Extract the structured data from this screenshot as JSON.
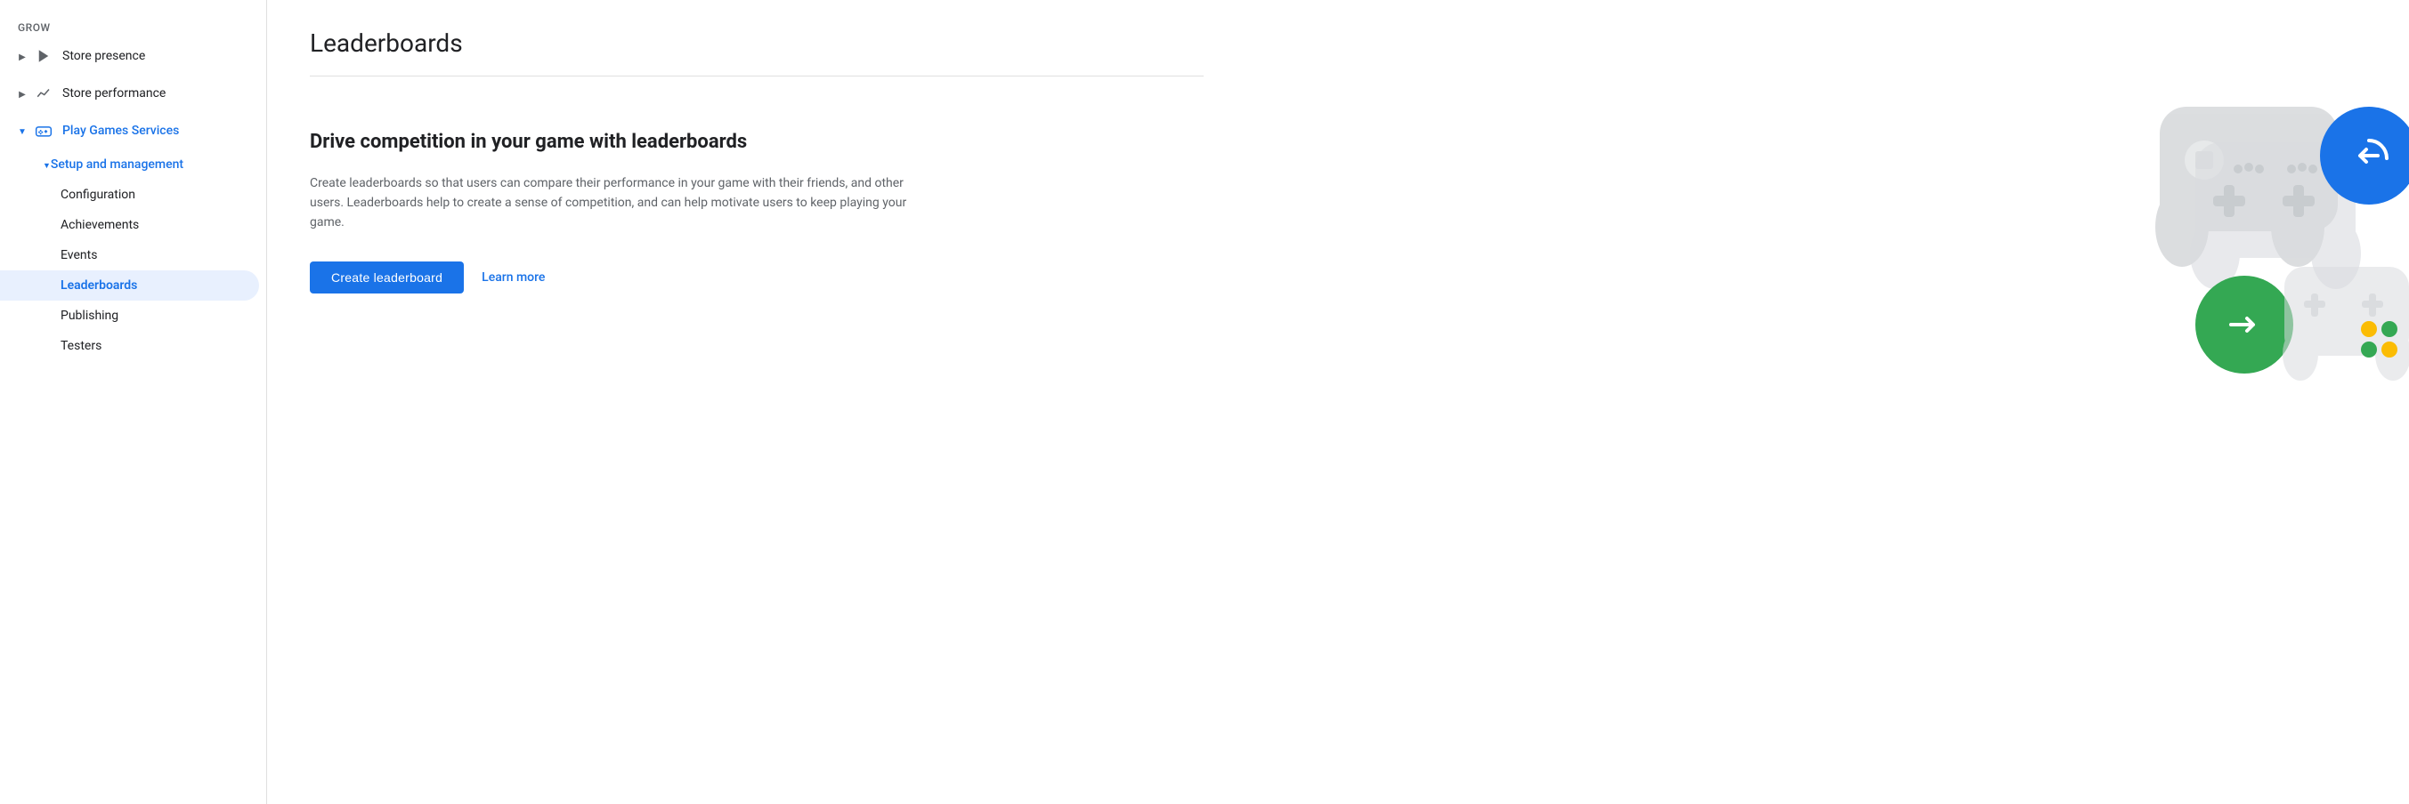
{
  "sidebar": {
    "grow_label": "Grow",
    "items": [
      {
        "id": "store-presence",
        "label": "Store presence",
        "icon": "play-icon",
        "expandable": true,
        "expanded": false,
        "indent": "top"
      },
      {
        "id": "store-performance",
        "label": "Store performance",
        "icon": "chart-icon",
        "expandable": true,
        "expanded": false,
        "indent": "top"
      },
      {
        "id": "play-games-services",
        "label": "Play Games Services",
        "icon": "gamepad-icon",
        "expandable": true,
        "expanded": true,
        "active": true,
        "indent": "top",
        "children": [
          {
            "id": "setup-management",
            "label": "Setup and management",
            "expandable": true,
            "expanded": true,
            "active": true,
            "children": [
              {
                "id": "configuration",
                "label": "Configuration"
              },
              {
                "id": "achievements",
                "label": "Achievements"
              },
              {
                "id": "events",
                "label": "Events"
              },
              {
                "id": "leaderboards",
                "label": "Leaderboards",
                "active": true
              },
              {
                "id": "publishing",
                "label": "Publishing"
              },
              {
                "id": "testers",
                "label": "Testers"
              }
            ]
          }
        ]
      }
    ]
  },
  "main": {
    "page_title": "Leaderboards",
    "headline": "Drive competition in your game with leaderboards",
    "description": "Create leaderboards so that users can compare their performance in your game with their friends, and other users. Leaderboards help to create a sense of competition, and can help motivate users to keep playing your game.",
    "create_button_label": "Create leaderboard",
    "learn_more_label": "Learn more"
  }
}
